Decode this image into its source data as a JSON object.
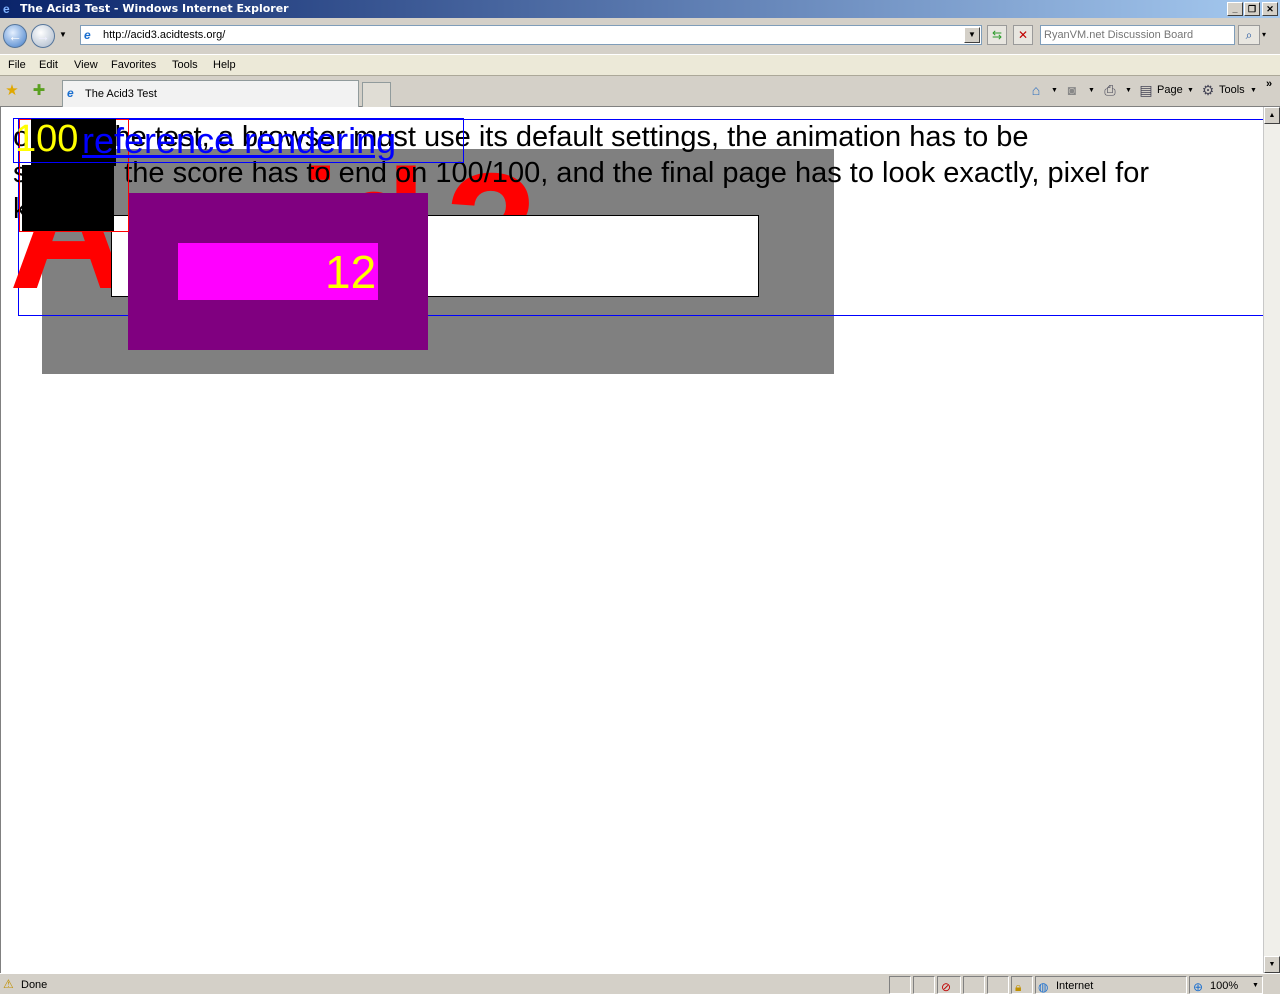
{
  "window": {
    "title": "The Acid3 Test - Windows Internet Explorer",
    "minimize": "_",
    "restore": "❐",
    "close": "✕"
  },
  "address": {
    "url": "http://acid3.acidtests.org/",
    "search_placeholder": "RyanVM.net Discussion Board"
  },
  "menu": {
    "file": "File",
    "edit": "Edit",
    "view": "View",
    "favorites": "Favorites",
    "tools": "Tools",
    "help": "Help"
  },
  "tabs": {
    "active_label": "The Acid3 Test"
  },
  "commandbar": {
    "page": "Page",
    "tools": "Tools",
    "chevron": "»"
  },
  "page": {
    "heading_big_left": "A",
    "heading_big_mid": "id",
    "heading_big_right": "3",
    "para_line1": "o pass the test, a browser must use its default settings, the animation has to be",
    "para_line2": "smooth, the score has to end on 100/100, and the final page has to look exactly, pixel for",
    "para_line3": "    k",
    "score": "100",
    "link": "reference rendering",
    "inner_score": "12"
  },
  "status": {
    "text": "Done",
    "zone": "Internet",
    "zoom": "100%"
  },
  "colors": {
    "acid_red": "#ff0000",
    "link_blue": "#0000ff",
    "score_yellow": "#ffff00",
    "purple": "#800080",
    "magenta": "#ff00ff",
    "gray": "#808080"
  }
}
